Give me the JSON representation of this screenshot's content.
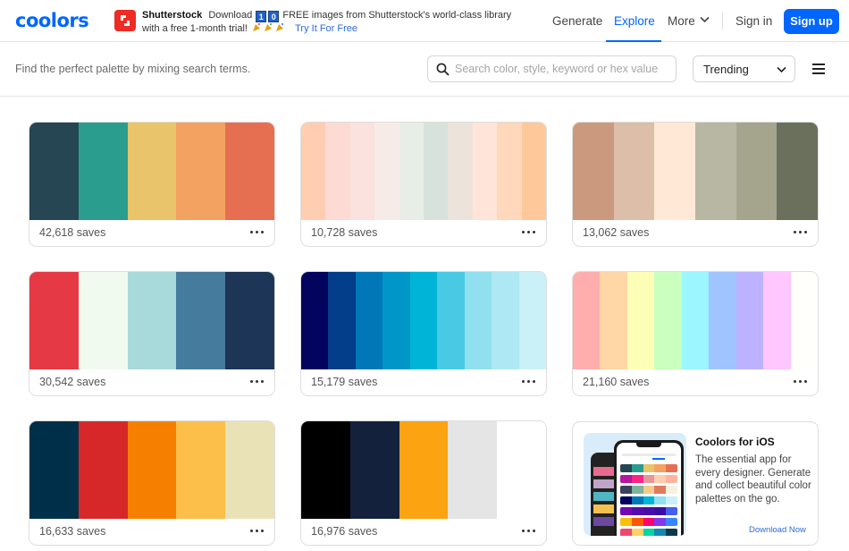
{
  "header": {
    "logo": "coolors",
    "promo": {
      "brand": "Shutterstock",
      "text_before": "Download",
      "digits": [
        "1",
        "0"
      ],
      "text_after": "FREE images from Shutterstock's world-class library",
      "line2": "with a free 1-month trial!",
      "cta": "Try It For Free"
    },
    "nav": {
      "generate": "Generate",
      "explore": "Explore",
      "more": "More",
      "sign_in": "Sign in",
      "sign_up": "Sign up"
    },
    "accent_color": "#0066ff"
  },
  "subbar": {
    "tagline": "Find the perfect palette by mixing search terms.",
    "search_placeholder": "Search color, style, keyword or hex value",
    "sort_value": "Trending"
  },
  "palettes": [
    {
      "colors": [
        "#264653",
        "#2a9d8f",
        "#e9c46a",
        "#f4a261",
        "#e76f51"
      ],
      "saves": "42,618 saves"
    },
    {
      "colors": [
        "#ffcdb2",
        "#fddad4",
        "#fbe2df",
        "#f7ebe8",
        "#e9ede8",
        "#d8e2dc",
        "#ece4db",
        "#ffe5d9",
        "#ffd7ba",
        "#fec89a"
      ],
      "saves": "10,728 saves"
    },
    {
      "colors": [
        "#cb997e",
        "#ddbea9",
        "#ffe8d6",
        "#b7b7a4",
        "#a5a58d",
        "#6b705c"
      ],
      "saves": "13,062 saves"
    },
    {
      "colors": [
        "#e63946",
        "#f1faee",
        "#a8dadc",
        "#457b9d",
        "#1d3557"
      ],
      "saves": "30,542 saves"
    },
    {
      "colors": [
        "#03045e",
        "#023e8a",
        "#0077b6",
        "#0096c7",
        "#00b4d8",
        "#48cae4",
        "#90e0ef",
        "#ade8f4",
        "#caf0f8"
      ],
      "saves": "15,179 saves"
    },
    {
      "colors": [
        "#ffadad",
        "#ffd6a5",
        "#fdffb6",
        "#caffbf",
        "#9bf6ff",
        "#a0c4ff",
        "#bdb2ff",
        "#ffc6ff",
        "#fffffc"
      ],
      "saves": "21,160 saves"
    },
    {
      "colors": [
        "#003049",
        "#d62828",
        "#f77f00",
        "#fcbf49",
        "#eae2b7"
      ],
      "saves": "16,633 saves"
    },
    {
      "colors": [
        "#000000",
        "#14213d",
        "#fca311",
        "#e5e5e5",
        "#ffffff"
      ],
      "saves": "16,976 saves"
    }
  ],
  "ios_promo": {
    "title": "Coolors for iOS",
    "description": "The essential app for every designer. Generate and collect beautiful color palettes on the go.",
    "link": "Download Now"
  }
}
